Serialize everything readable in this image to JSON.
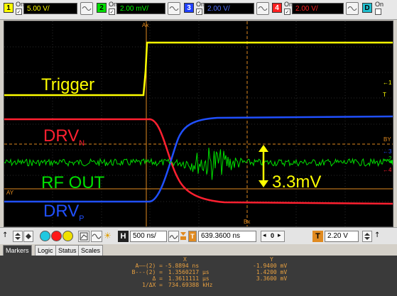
{
  "channels": [
    {
      "num": "1",
      "on_label": "On",
      "value": "5.00 V/",
      "color": "#ffff00",
      "bg": "#ffff00"
    },
    {
      "num": "2",
      "on_label": "On",
      "value": "2.00 mV/",
      "color": "#00ff00",
      "bg": "#00dd00"
    },
    {
      "num": "3",
      "on_label": "On",
      "value": "2.00 V/",
      "color": "#3060ff",
      "bg": "#2040ff"
    },
    {
      "num": "4",
      "on_label": "On",
      "value": "2.00 V/",
      "color": "#ff1010",
      "bg": "#ff2020"
    }
  ],
  "digital": {
    "label": "D",
    "on_label": "On"
  },
  "screen": {
    "labels": {
      "trigger": "Trigger",
      "drvn_main": "DRV",
      "drvn_sub": "N",
      "rfout": "RF OUT",
      "drvp_main": "DRV",
      "drvp_sub": "P",
      "amplitude": "3.3mV"
    },
    "markers": {
      "ax": "Ax",
      "bx": "Bx",
      "ay": "AY",
      "by": "BY"
    },
    "right_indicators": {
      "t1": "←1",
      "t2": "←2",
      "t3": "←3",
      "t4": "←4"
    },
    "colors": {
      "ch1": "#ffff00",
      "ch2": "#00e000",
      "ch3": "#2050ff",
      "ch4": "#ff2030",
      "marker": "#e08a20"
    }
  },
  "toolbar": {
    "horiz_label": "H",
    "timebase": "500 ns/",
    "delay": "639.3600 ns",
    "zoom": "0",
    "trigger_label": "T",
    "trigger_level": "2.20 V"
  },
  "tabs": [
    "Markers",
    "Logic",
    "Status",
    "Scales"
  ],
  "markers_panel": {
    "header_x": "X",
    "header_y": "Y",
    "rows": [
      {
        "name": "A——(2) =",
        "x": "-5.8894 ns",
        "y": "-1.9400 mV"
      },
      {
        "name": "B---(2) =",
        "x": " 1.3560217 µs",
        "y": " 1.4200 mV"
      },
      {
        "name": "Δ =",
        "x": " 1.3611111 µs",
        "y": " 3.3600 mV"
      },
      {
        "name": "1/ΔX =",
        "x": " 734.69388 kHz",
        "y": ""
      }
    ]
  }
}
